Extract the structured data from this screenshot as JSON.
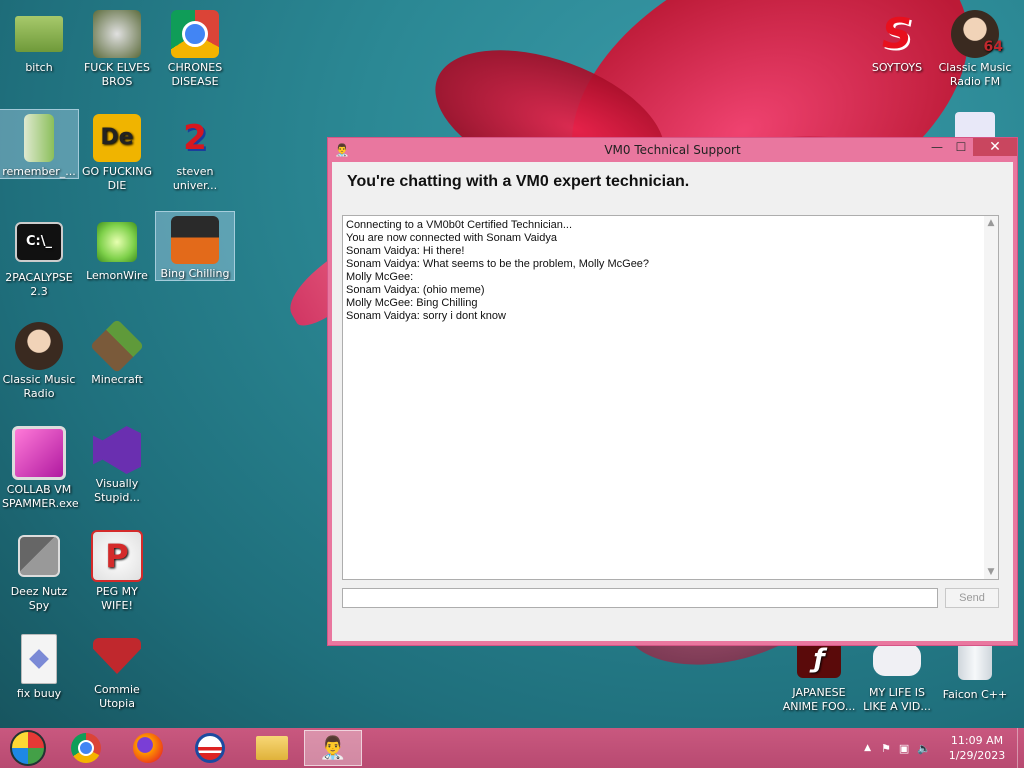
{
  "desktop": {
    "icons_left": [
      {
        "name": "bitch",
        "label": "bitch"
      },
      {
        "name": "fuck-elves-bros",
        "label": "FUCK ELVES BROS"
      },
      {
        "name": "chrones-disease",
        "label": "CHRONES DISEASE"
      },
      {
        "name": "remember",
        "label": "remember_..."
      },
      {
        "name": "go-fucking-die",
        "label": "GO FUCKING DIE"
      },
      {
        "name": "steven-univer",
        "label": "steven univer..."
      },
      {
        "name": "2pacalypse",
        "label": "2PACALYPSE 2.3"
      },
      {
        "name": "lemonwire",
        "label": "LemonWire"
      },
      {
        "name": "bing-chilling",
        "label": "Bing Chilling"
      },
      {
        "name": "classic-music-radio",
        "label": "Classic Music Radio"
      },
      {
        "name": "minecraft",
        "label": "Minecraft"
      },
      {
        "name": "collab-vm-spammer",
        "label": "COLLAB VM SPAMMER.exe"
      },
      {
        "name": "visually-stupid",
        "label": "Visually Stupid..."
      },
      {
        "name": "deez-nutz-spy",
        "label": "Deez Nutz Spy"
      },
      {
        "name": "peg-my-wife",
        "label": "PEG MY WIFE!"
      },
      {
        "name": "fix-buuy",
        "label": "fix buuy"
      },
      {
        "name": "commie-utopia",
        "label": "Commie Utopia"
      }
    ],
    "icons_right": [
      {
        "name": "soytoys",
        "label": "SOYTOYS"
      },
      {
        "name": "classic-music-radio-fm",
        "label": "Classic Music Radio FM"
      },
      {
        "name": "japanese-anime-foo",
        "label": "JAPANESE ANIME FOO..."
      },
      {
        "name": "my-life-is-like-a-vid",
        "label": "MY LIFE IS LIKE A VID..."
      },
      {
        "name": "faicon-cpp",
        "label": "Faicon C++"
      }
    ],
    "icon_glyphs": {
      "de": "De",
      "two": "2",
      "cmd": "C:\\_",
      "p": "P",
      "s": "S",
      "badge64": "64"
    }
  },
  "chat_window": {
    "title": "VM0 Technical Support",
    "heading": "You're chatting with a VM0 expert technician.",
    "messages": [
      "Connecting to a VM0b0t Certified Technician...",
      "You are now connected with Sonam Vaidya",
      "Sonam Vaidya: Hi there!",
      "Sonam Vaidya: What seems to be the problem, Molly McGee?",
      "Molly McGee:",
      "Sonam Vaidya: (ohio meme)",
      "Molly McGee: Bing Chilling",
      "Sonam Vaidya: sorry i dont know"
    ],
    "input_value": "",
    "send_label": "Send"
  },
  "taskbar": {
    "apps": [
      "start-orb",
      "chrome",
      "firefox",
      "obama",
      "file-explorer",
      "vm0-support"
    ],
    "time": "11:09 AM",
    "date": "1/29/2023"
  },
  "colors": {
    "title_bar": "#e9779f",
    "close_button": "#c9465f",
    "taskbar": "#c0517a"
  }
}
